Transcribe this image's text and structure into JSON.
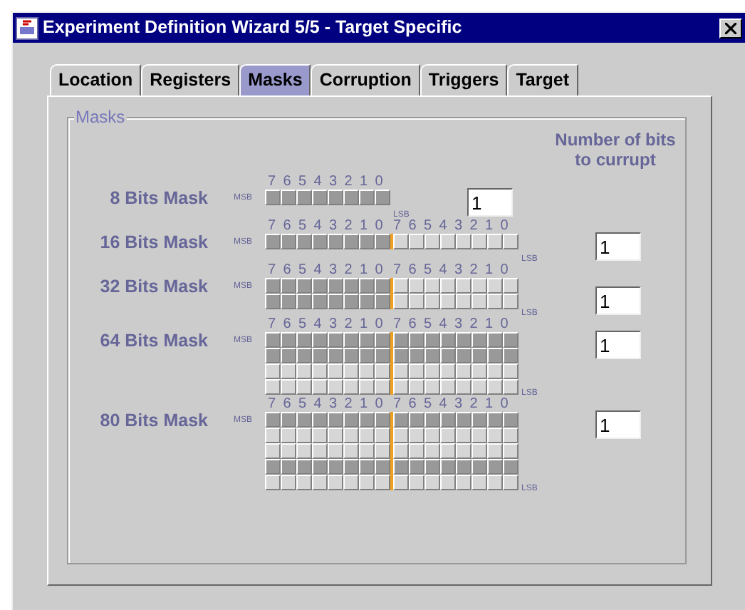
{
  "window": {
    "title": "Experiment Definition Wizard 5/5 - Target Specific"
  },
  "tabs": [
    {
      "label": "Location",
      "selected": false
    },
    {
      "label": "Registers",
      "selected": false
    },
    {
      "label": "Masks",
      "selected": true
    },
    {
      "label": "Corruption",
      "selected": false
    },
    {
      "label": "Triggers",
      "selected": false
    },
    {
      "label": "Target",
      "selected": false
    }
  ],
  "group": {
    "title": "Masks",
    "count_heading": "Number of bits to currupt"
  },
  "masks": [
    {
      "label": "8 Bits Mask",
      "msb": "MSB",
      "lsb": "LSB",
      "bit_headers": [
        "7 6 5 4 3 2 1 0"
      ],
      "rows": [
        {
          "bytes": [
            {
              "filled": true
            }
          ]
        }
      ],
      "bits_to_corrupt": "1"
    },
    {
      "label": "16 Bits Mask",
      "msb": "MSB",
      "lsb": "LSB",
      "bit_headers": [
        "7 6 5 4 3 2 1 0",
        "7 6 5 4 3 2 1 0"
      ],
      "rows": [
        {
          "bytes": [
            {
              "filled": true
            },
            {
              "filled": false
            }
          ]
        }
      ],
      "bits_to_corrupt": "1"
    },
    {
      "label": "32 Bits Mask",
      "msb": "MSB",
      "lsb": "LSB",
      "bit_headers": [
        "7 6 5 4 3 2 1 0",
        "7 6 5 4 3 2 1 0"
      ],
      "rows": [
        {
          "bytes": [
            {
              "filled": true
            },
            {
              "filled": false
            }
          ]
        },
        {
          "bytes": [
            {
              "filled": true
            },
            {
              "filled": false
            }
          ]
        }
      ],
      "bits_to_corrupt": "1"
    },
    {
      "label": "64 Bits Mask",
      "msb": "MSB",
      "lsb": "LSB",
      "bit_headers": [
        "7 6 5 4 3 2 1 0",
        "7 6 5 4 3 2 1 0"
      ],
      "rows": [
        {
          "bytes": [
            {
              "filled": true
            },
            {
              "filled": true
            }
          ]
        },
        {
          "bytes": [
            {
              "filled": true
            },
            {
              "filled": true
            }
          ]
        },
        {
          "bytes": [
            {
              "filled": false
            },
            {
              "filled": false
            }
          ]
        },
        {
          "bytes": [
            {
              "filled": false
            },
            {
              "filled": false
            }
          ]
        }
      ],
      "bits_to_corrupt": "1"
    },
    {
      "label": "80 Bits Mask",
      "msb": "MSB",
      "lsb": "LSB",
      "bit_headers": [
        "7 6 5 4 3 2 1 0",
        "7 6 5 4 3 2 1 0"
      ],
      "rows": [
        {
          "bytes": [
            {
              "filled": true
            },
            {
              "filled": true
            }
          ]
        },
        {
          "bytes": [
            {
              "filled": false
            },
            {
              "filled": false
            }
          ]
        },
        {
          "bytes": [
            {
              "filled": false
            },
            {
              "filled": false
            }
          ]
        },
        {
          "bytes": [
            {
              "filled": true
            },
            {
              "filled": true
            }
          ]
        },
        {
          "bytes": [
            {
              "filled": false
            },
            {
              "filled": false
            }
          ]
        }
      ],
      "bits_to_corrupt": "1"
    }
  ]
}
